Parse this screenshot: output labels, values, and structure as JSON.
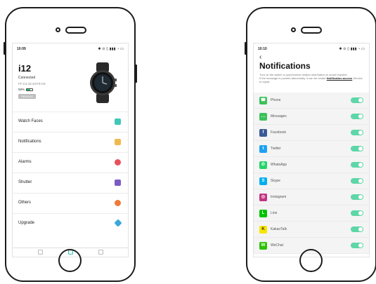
{
  "left_screen": {
    "status_time": "10:09",
    "status_icons": "✱ ⊙ ▯ ▮▮▮ ◔ ▭",
    "device_name": "i12",
    "connection_status": "Connected",
    "mac": "FF:C4:42:43:F9:C8",
    "battery_label": "58%",
    "battery_level": 0.58,
    "remove_label": "REMOVE",
    "menu": [
      {
        "label": "Watch Faces",
        "icon": "watch-faces-icon",
        "color": "#3fc8b8"
      },
      {
        "label": "Notifications",
        "icon": "notifications-icon",
        "color": "#f2b84b"
      },
      {
        "label": "Alarms",
        "icon": "alarm-icon",
        "color": "#e8505b"
      },
      {
        "label": "Shutter",
        "icon": "camera-icon",
        "color": "#7a5cc4"
      },
      {
        "label": "Others",
        "icon": "gear-icon",
        "color": "#ef7a3a"
      },
      {
        "label": "Upgrade",
        "icon": "upgrade-icon",
        "color": "#3aa8d8"
      }
    ]
  },
  "right_screen": {
    "status_time": "10:10",
    "status_icons": "✱ ⊙ ▯ ▮▮▮ ◔ ▭",
    "back_glyph": "‹",
    "title": "Notifications",
    "desc_line1": "Turn on the switch to synchronize related information to smart bracelet.",
    "desc_line2_pre": "If the message is pushed abnormally, it can be restart ",
    "desc_link": "Notification access",
    "desc_line2_post": " Service to repair",
    "apps": [
      {
        "label": "Phone",
        "icon": "phone-icon",
        "color": "#3cc15a",
        "glyph": "☎",
        "enabled": true
      },
      {
        "label": "Messages",
        "icon": "messages-icon",
        "color": "#3cc15a",
        "glyph": "…",
        "enabled": true
      },
      {
        "label": "Facebook",
        "icon": "facebook-icon",
        "color": "#3b5998",
        "glyph": "f",
        "enabled": true
      },
      {
        "label": "Twitter",
        "icon": "twitter-icon",
        "color": "#1da1f2",
        "glyph": "t",
        "enabled": true
      },
      {
        "label": "WhatsApp",
        "icon": "whatsapp-icon",
        "color": "#25d366",
        "glyph": "✆",
        "enabled": true
      },
      {
        "label": "Skype",
        "icon": "skype-icon",
        "color": "#00aff0",
        "glyph": "S",
        "enabled": true
      },
      {
        "label": "Instagram",
        "icon": "instagram-icon",
        "color": "#c13584",
        "glyph": "◎",
        "enabled": true
      },
      {
        "label": "Line",
        "icon": "line-icon",
        "color": "#00c300",
        "glyph": "L",
        "enabled": true
      },
      {
        "label": "KakaoTalk",
        "icon": "kakaotalk-icon",
        "color": "#f7e600",
        "glyph": "K",
        "enabled": true
      },
      {
        "label": "WeChat",
        "icon": "wechat-icon",
        "color": "#2dc100",
        "glyph": "W",
        "enabled": true
      }
    ]
  }
}
